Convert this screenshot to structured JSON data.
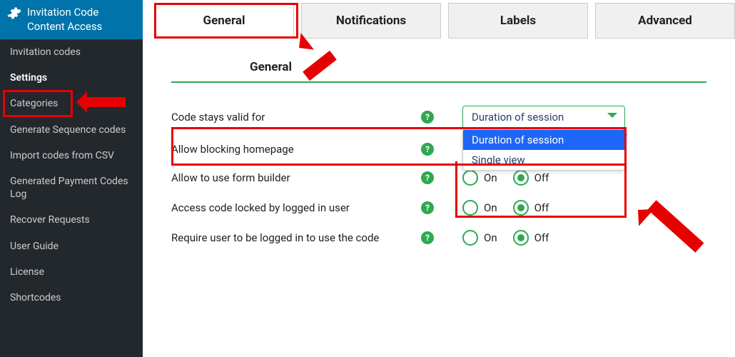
{
  "sidebar": {
    "header": "Invitation Code Content Access",
    "items": [
      {
        "label": "Invitation codes"
      },
      {
        "label": "Settings"
      },
      {
        "label": "Categories"
      },
      {
        "label": "Generate Sequence codes"
      },
      {
        "label": "Import codes from CSV"
      },
      {
        "label": "Generated Payment Codes Log"
      },
      {
        "label": "Recover Requests"
      },
      {
        "label": "User Guide"
      },
      {
        "label": "License"
      },
      {
        "label": "Shortcodes"
      }
    ],
    "active_index": 1
  },
  "tabs": {
    "items": [
      {
        "label": "General"
      },
      {
        "label": "Notifications"
      },
      {
        "label": "Labels"
      },
      {
        "label": "Advanced"
      }
    ],
    "active_index": 0
  },
  "section_title": "General",
  "rows": {
    "validity": {
      "label": "Code stays valid for",
      "select_value": "Duration of session",
      "options": [
        "Duration of session",
        "Single view"
      ]
    },
    "homepage": {
      "label": "Allow blocking homepage"
    },
    "formbuilder": {
      "label": "Allow to use form builder",
      "on": "On",
      "off": "Off",
      "value": "off"
    },
    "locked": {
      "label": "Access code locked by logged in user",
      "on": "On",
      "off": "Off",
      "value": "off"
    },
    "require_login": {
      "label": "Require user to be logged in to use the code",
      "on": "On",
      "off": "Off",
      "value": "off"
    }
  },
  "help_glyph": "?"
}
